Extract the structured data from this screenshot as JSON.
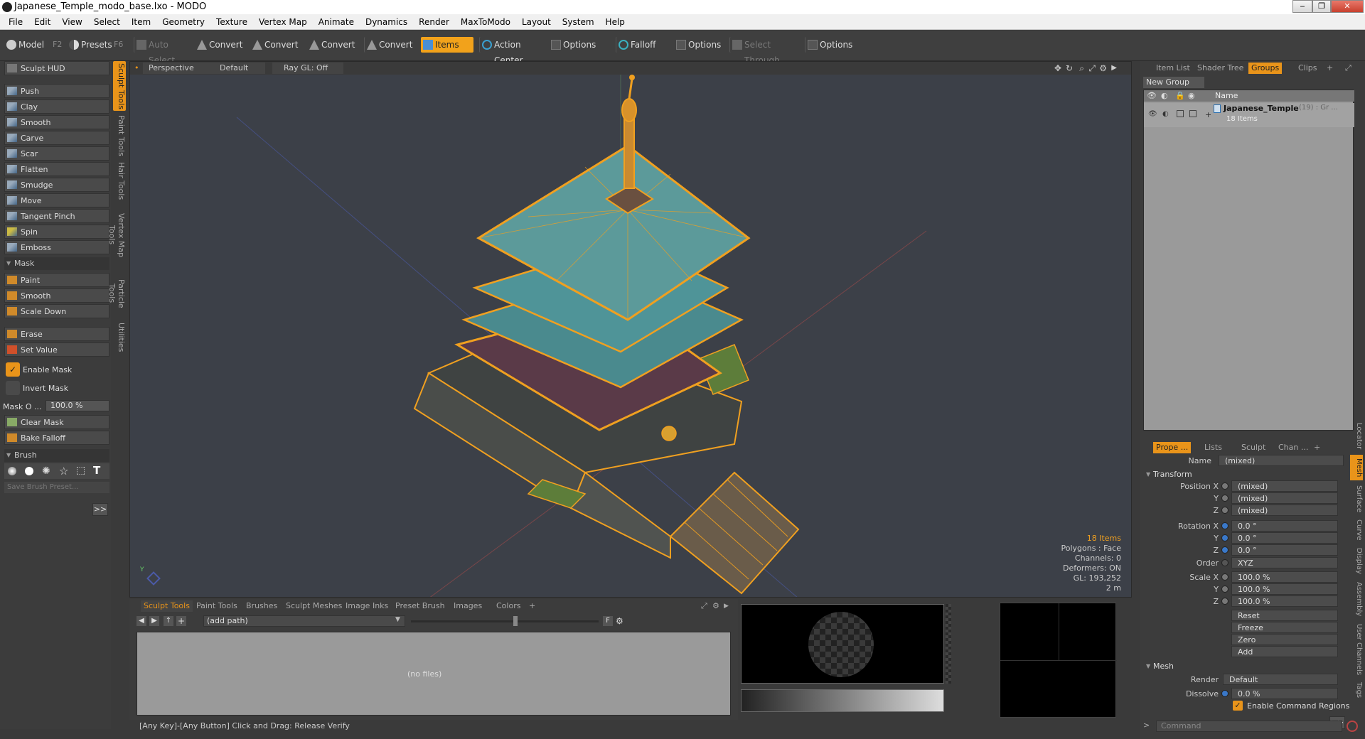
{
  "window": {
    "title": "Japanese_Temple_modo_base.lxo - MODO",
    "buttons": [
      "‒",
      "❐",
      "✕"
    ]
  },
  "menubar": [
    "File",
    "Edit",
    "View",
    "Select",
    "Item",
    "Geometry",
    "Texture",
    "Vertex Map",
    "Animate",
    "Dynamics",
    "Render",
    "MaxToModo",
    "Layout",
    "System",
    "Help"
  ],
  "toolbar": {
    "model": "Model",
    "model_key": "F2",
    "presets": "Presets",
    "presets_key": "F6",
    "auto_select": "Auto Select",
    "convert1": "Convert",
    "convert2": "Convert",
    "convert3": "Convert",
    "convert4": "Convert",
    "items": "Items",
    "action_center": "Action Center",
    "options1": "Options",
    "falloff": "Falloff",
    "options2": "Options",
    "select_through": "Select Through",
    "options3": "Options"
  },
  "left": {
    "hud": "Sculpt HUD",
    "tools": [
      "Push",
      "Clay",
      "Smooth",
      "Carve",
      "Scar",
      "Flatten",
      "Smudge",
      "Move",
      "Tangent Pinch",
      "Spin",
      "Emboss"
    ],
    "mask_header": "Mask",
    "mask_tools": [
      "Paint",
      "Smooth",
      "Scale Down"
    ],
    "erase": "Erase",
    "set_value": "Set Value",
    "enable_mask": "Enable Mask",
    "invert_mask": "Invert Mask",
    "mask_opacity_label": "Mask O ...",
    "mask_opacity_value": "100.0 %",
    "clear_mask": "Clear Mask",
    "bake_falloff": "Bake Falloff",
    "brush_header": "Brush",
    "save_brush_preset": "Save Brush Preset...",
    "more": ">>"
  },
  "vtabs": [
    "Sculpt Tools",
    "Paint Tools",
    "Hair Tools",
    "Vertex Map Tools",
    "Particle Tools",
    "Utilities"
  ],
  "viewport": {
    "view": "Perspective",
    "shading": "Default",
    "raygl": "Ray GL: Off",
    "stats": {
      "items": "18 Items",
      "polygons": "Polygons : Face",
      "channels": "Channels: 0",
      "deformers": "Deformers: ON",
      "gl": "GL: 193,252",
      "scale": "2 m"
    }
  },
  "bottom": {
    "tabs": [
      "Sculpt Tools",
      "Paint Tools",
      "Brushes",
      "Sculpt Meshes",
      "Image Inks",
      "Preset Brush",
      "Images",
      "Colors",
      "+"
    ],
    "path": "(add path)",
    "no_files": "(no files)",
    "f_label": "F"
  },
  "status": "[Any Key]-[Any Button] Click and Drag:   Release Verify",
  "right": {
    "tabs": [
      "Item List",
      "Shader Tree",
      "Groups",
      "Clips",
      "+"
    ],
    "new_group": "New Group",
    "name_col": "Name",
    "group_name": "Japanese_Temple",
    "group_extra": "(19) : Gr ...",
    "group_count": "18 Items",
    "prop_tabs": [
      "Prope ...",
      "Lists",
      "Sculpt",
      "Chan ...",
      "+"
    ],
    "name_label": "Name",
    "name_value": "(mixed)",
    "transform": "Transform",
    "position_label": "Position X",
    "y_label": "Y",
    "z_label": "Z",
    "pos": [
      "(mixed)",
      "(mixed)",
      "(mixed)"
    ],
    "rotation_label": "Rotation X",
    "rot": [
      "0.0 °",
      "0.0 °",
      "0.0 °"
    ],
    "order_label": "Order",
    "order_value": "XYZ",
    "scale_label": "Scale X",
    "scale": [
      "100.0 %",
      "100.0 %",
      "100.0 %"
    ],
    "actions": [
      "Reset",
      "Freeze",
      "Zero",
      "Add"
    ],
    "mesh": "Mesh",
    "render_label": "Render",
    "render_value": "Default",
    "dissolve_label": "Dissolve",
    "dissolve_value": "0.0 %",
    "enable_cmd": "Enable Command Regions",
    "more": ">>",
    "command": "Command",
    "side_tabs": [
      "Locator",
      "Mesh",
      "Surface",
      "Curve",
      "Display",
      "Assembly",
      "User Channels",
      "Tags"
    ]
  },
  "colors": {
    "accent": "#f2a21b",
    "wire": "#f0a020",
    "roof": "#5c9a9a"
  }
}
